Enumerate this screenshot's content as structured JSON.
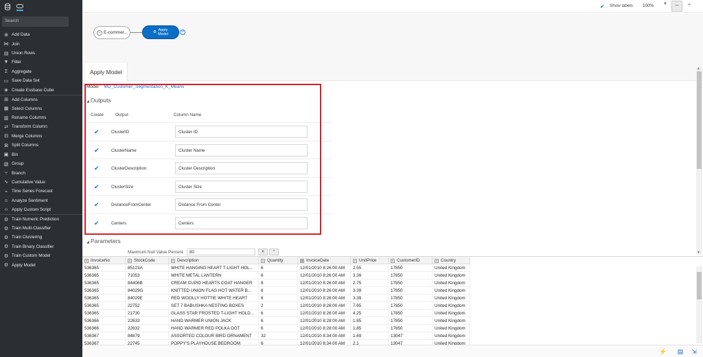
{
  "sidebar": {
    "search_placeholder": "Search",
    "items": [
      {
        "label": "Add Data",
        "icon": "add-data-icon",
        "glyph": "⊕"
      },
      {
        "label": "Join",
        "icon": "join-icon",
        "glyph": "⋈"
      },
      {
        "label": "Union Rows",
        "icon": "union-rows-icon",
        "glyph": "▤"
      },
      {
        "label": "Filter",
        "icon": "filter-icon",
        "glyph": "▼"
      },
      {
        "label": "Aggregate",
        "icon": "aggregate-icon",
        "glyph": "Σ"
      },
      {
        "label": "Save Data Set",
        "icon": "save-icon",
        "glyph": "▭"
      },
      {
        "label": "Create Essbase Cube",
        "icon": "cube-icon",
        "glyph": "◈"
      },
      {
        "label": "Add Columns",
        "icon": "add-columns-icon",
        "glyph": "⊞"
      },
      {
        "label": "Select Columns",
        "icon": "select-columns-icon",
        "glyph": "▦"
      },
      {
        "label": "Rename Columns",
        "icon": "rename-columns-icon",
        "glyph": "▥"
      },
      {
        "label": "Transform Column",
        "icon": "transform-column-icon",
        "glyph": "⇄"
      },
      {
        "label": "Merge Columns",
        "icon": "merge-columns-icon",
        "glyph": "⊟"
      },
      {
        "label": "Split Columns",
        "icon": "split-columns-icon",
        "glyph": "⊠"
      },
      {
        "label": "Bin",
        "icon": "bin-icon",
        "glyph": "▣"
      },
      {
        "label": "Group",
        "icon": "group-icon",
        "glyph": "▧"
      },
      {
        "label": "Branch",
        "icon": "branch-icon",
        "glyph": "⑂"
      },
      {
        "label": "Cumulative Value",
        "icon": "cumulative-icon",
        "glyph": "∿"
      },
      {
        "label": "Time Series Forecast",
        "icon": "forecast-icon",
        "glyph": "⌁"
      },
      {
        "label": "Analyze Sentiment",
        "icon": "sentiment-icon",
        "glyph": "☺"
      },
      {
        "label": "Apply Custom Script",
        "icon": "script-icon",
        "glyph": "‹›"
      },
      {
        "label": "Train Numeric Prediction",
        "icon": "train-numeric-icon",
        "glyph": "⚙"
      },
      {
        "label": "Train Multi-Classifier",
        "icon": "train-multi-icon",
        "glyph": "⚙"
      },
      {
        "label": "Train Clustering",
        "icon": "train-clustering-icon",
        "glyph": "⚙"
      },
      {
        "label": "Train Binary Classifier",
        "icon": "train-binary-icon",
        "glyph": "⚙"
      },
      {
        "label": "Train Custom Model",
        "icon": "train-custom-icon",
        "glyph": "⚙"
      },
      {
        "label": "Apply Model",
        "icon": "apply-model-icon",
        "glyph": "⚙"
      }
    ]
  },
  "topbar": {
    "show_labels": "Show labels",
    "zoom": "100%",
    "minus": "−",
    "plus": "+"
  },
  "canvas": {
    "source_node": "E-commer...",
    "apply_node_line1": "Apply",
    "apply_node_line2": "Model"
  },
  "panel": {
    "tab_label": "Apply Model",
    "model_label": "Model",
    "model_name": "MD_Customer_Segmentation_K_Means",
    "outputs_title": "Outputs",
    "columns": {
      "create": "Create",
      "output": "Output",
      "column_name": "Column Name"
    },
    "outputs": [
      {
        "output": "ClusterID",
        "column_name": "Cluster ID",
        "checked": true
      },
      {
        "output": "ClusterName",
        "column_name": "Cluster Name",
        "checked": true
      },
      {
        "output": "ClusterDescription",
        "column_name": "Cluster Description",
        "checked": true
      },
      {
        "output": "ClusterSize",
        "column_name": "Cluster Size",
        "checked": true
      },
      {
        "output": "DistanceFromCenter",
        "column_name": "Distance From Center",
        "checked": true
      },
      {
        "output": "Centers",
        "column_name": "Centers",
        "checked": true
      }
    ],
    "parameters_title": "Parameters",
    "param_label": "Maximum Null Value Percent",
    "param_value": "80"
  },
  "grid": {
    "headers": [
      {
        "label": "InvoiceNo",
        "type": "A"
      },
      {
        "label": "StockCode",
        "type": "A"
      },
      {
        "label": "Description",
        "type": "A"
      },
      {
        "label": "Quantity",
        "type": "#"
      },
      {
        "label": "InvoiceDate",
        "type": "▦"
      },
      {
        "label": "UnitPrice",
        "type": "#"
      },
      {
        "label": "CustomerID",
        "type": "A"
      },
      {
        "label": "Country",
        "type": "A"
      }
    ],
    "rows": [
      [
        "536365",
        "85123A",
        "WHITE HANGING HEART T-LIGHT HOL...",
        "6",
        "12/01/2010 8:26:00 AM",
        "2.55",
        "17850",
        "United Kingdom"
      ],
      [
        "536365",
        "71053",
        "WHITE METAL LANTERN",
        "6",
        "12/01/2010 8:26:00 AM",
        "3.39",
        "17850",
        "United Kingdom"
      ],
      [
        "536365",
        "84406B",
        "CREAM CUPID HEARTS COAT HANGER",
        "8",
        "12/01/2010 8:26:00 AM",
        "2.75",
        "17850",
        "United Kingdom"
      ],
      [
        "536365",
        "84029G",
        "KNITTED UNION FLAG HOT WATER B...",
        "6",
        "12/01/2010 8:26:00 AM",
        "3.39",
        "17850",
        "United Kingdom"
      ],
      [
        "536365",
        "84029E",
        "RED WOOLLY HOTTIE WHITE HEART",
        "6",
        "12/01/2010 8:26:00 AM",
        "3.39",
        "17850",
        "United Kingdom"
      ],
      [
        "536365",
        "22752",
        "SET 7 BABUSHKA NESTING BOXES",
        "2",
        "12/01/2010 8:26:00 AM",
        "7.65",
        "17850",
        "United Kingdom"
      ],
      [
        "536365",
        "21730",
        "GLASS STAR FROSTED T-LIGHT HOLD...",
        "6",
        "12/01/2010 8:26:00 AM",
        "4.25",
        "17850",
        "United Kingdom"
      ],
      [
        "536366",
        "22633",
        "HAND WARMER UNION JACK",
        "6",
        "12/01/2010 8:28:00 AM",
        "1.85",
        "17850",
        "United Kingdom"
      ],
      [
        "536366",
        "22632",
        "HAND WARMER RED POLKA DOT",
        "6",
        "12/01/2010 8:28:00 AM",
        "1.85",
        "17850",
        "United Kingdom"
      ],
      [
        "536367",
        "84879",
        "ASSORTED COLOUR BIRD ORNAMENT",
        "32",
        "12/01/2010 8:34:00 AM",
        "1.69",
        "13047",
        "United Kingdom"
      ],
      [
        "536367",
        "22745",
        "POPPY'S PLAYHOUSE BEDROOM",
        "6",
        "12/01/2010 8:34:00 AM",
        "2.1",
        "13047",
        "United Kingdom"
      ]
    ]
  },
  "colors": {
    "accent": "#1b6ac9",
    "node_blue": "#0a6ec6",
    "highlight_red": "#d81f26",
    "sidebar_bg": "#2b2f33"
  }
}
